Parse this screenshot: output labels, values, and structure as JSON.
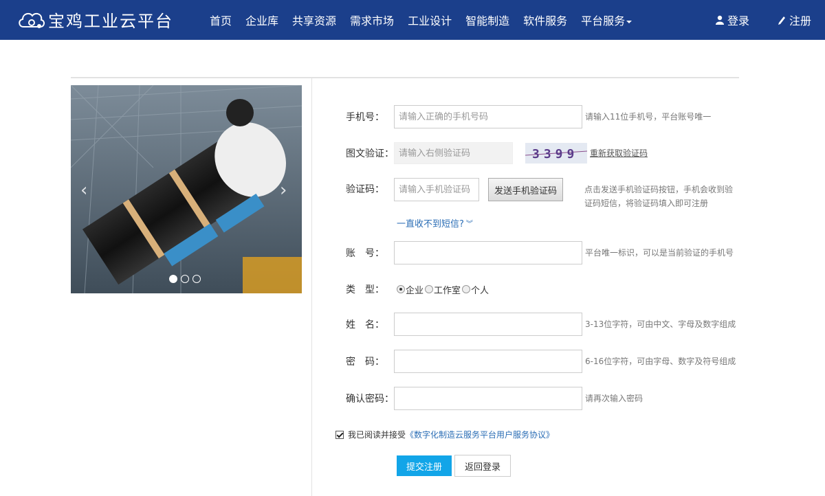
{
  "header": {
    "logo_text": "宝鸡工业云平台",
    "nav": [
      "首页",
      "企业库",
      "共享资源",
      "需求市场",
      "工业设计",
      "智能制造",
      "软件服务",
      "平台服务"
    ],
    "login": "登录",
    "register": "注册"
  },
  "carousel": {
    "prev": "‹",
    "next": "›",
    "dots": 3,
    "active_dot": 0
  },
  "form": {
    "phone": {
      "label": "手机号：",
      "placeholder": "请输入正确的手机号码",
      "hint": "请输入11位手机号，平台账号唯一"
    },
    "captcha": {
      "label": "图文验证：",
      "placeholder": "请输入右侧验证码",
      "code": "3399",
      "refresh": "重新获取验证码"
    },
    "sms": {
      "label": "验证码：",
      "placeholder": "请输入手机验证码",
      "send_button": "发送手机验证码",
      "hint_line1": "点击发送手机验证码按钮，手机会收到验",
      "hint_line2": "证码短信，将验证码填入即可注册",
      "help_link": "一直收不到短信?"
    },
    "account": {
      "label": "账　号：",
      "hint": "平台唯一标识，可以是当前验证的手机号"
    },
    "type": {
      "label": "类　型：",
      "options": [
        "企业",
        "工作室",
        "个人"
      ],
      "selected": "企业"
    },
    "name": {
      "label": "姓　名：",
      "hint": "3-13位字符，可由中文、字母及数字组成"
    },
    "password": {
      "label": "密　码：",
      "hint": "6-16位字符，可由字母、数字及符号组成"
    },
    "confirm": {
      "label": "确认密码：",
      "hint": "请再次输入密码"
    },
    "agreement": {
      "text": "我已阅读并接受",
      "link": "《数字化制造云服务平台用户服务协议》",
      "checked": true
    },
    "submit": "提交注册",
    "back": "返回登录"
  },
  "colors": {
    "topbar": "#1b3f8b",
    "primary": "#12a5e8",
    "link": "#2a6db5"
  }
}
